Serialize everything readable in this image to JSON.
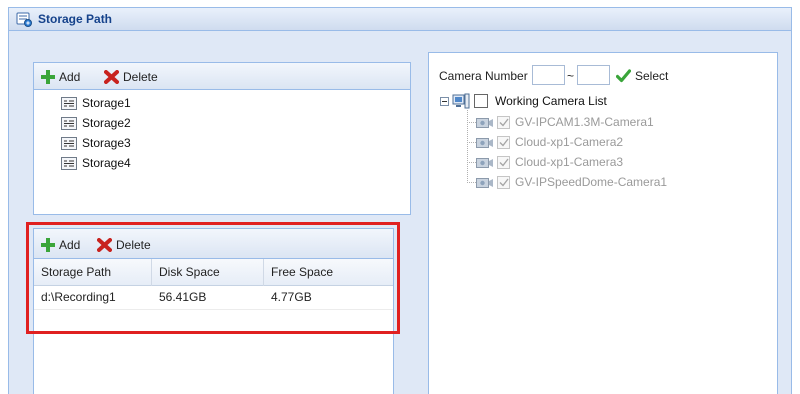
{
  "window": {
    "title": "Storage Path"
  },
  "storage_toolbar": {
    "add_label": "Add",
    "delete_label": "Delete"
  },
  "storage_list": [
    {
      "label": "Storage1"
    },
    {
      "label": "Storage2"
    },
    {
      "label": "Storage3"
    },
    {
      "label": "Storage4"
    }
  ],
  "path_toolbar": {
    "add_label": "Add",
    "delete_label": "Delete"
  },
  "path_table": {
    "columns": [
      "Storage Path",
      "Disk Space",
      "Free Space"
    ],
    "rows": [
      [
        "d:\\Recording1",
        "56.41GB",
        "4.77GB"
      ]
    ]
  },
  "camera_filter": {
    "label": "Camera Number",
    "from_value": "",
    "separator": "~",
    "to_value": "",
    "select_label": "Select"
  },
  "camera_tree": {
    "root_label": "Working Camera List",
    "cameras": [
      {
        "label": "GV-IPCAM1.3M-Camera1",
        "checked": true
      },
      {
        "label": "Cloud-xp1-Camera2",
        "checked": true
      },
      {
        "label": "Cloud-xp1-Camera3",
        "checked": true
      },
      {
        "label": "GV-IPSpeedDome-Camera1",
        "checked": true
      }
    ]
  },
  "colors": {
    "highlight_border": "#e02020",
    "title_text": "#15428b",
    "panel_border": "#99bbe8",
    "add_icon": "#3aa53a",
    "delete_icon": "#c8231f",
    "select_check": "#3aa53a"
  },
  "icons": {
    "title": "storage-drive-icon",
    "add": "plus-icon",
    "delete": "x-icon",
    "storage_item": "storage-node-icon",
    "select": "checkmark-icon",
    "camera": "camera-icon"
  }
}
